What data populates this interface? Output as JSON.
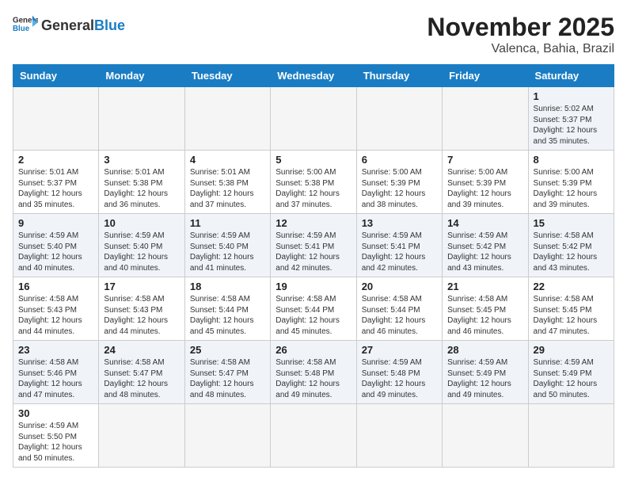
{
  "header": {
    "logo_general": "General",
    "logo_blue": "Blue",
    "month_title": "November 2025",
    "location": "Valenca, Bahia, Brazil"
  },
  "weekdays": [
    "Sunday",
    "Monday",
    "Tuesday",
    "Wednesday",
    "Thursday",
    "Friday",
    "Saturday"
  ],
  "weeks": [
    [
      {
        "day": "",
        "info": ""
      },
      {
        "day": "",
        "info": ""
      },
      {
        "day": "",
        "info": ""
      },
      {
        "day": "",
        "info": ""
      },
      {
        "day": "",
        "info": ""
      },
      {
        "day": "",
        "info": ""
      },
      {
        "day": "1",
        "info": "Sunrise: 5:02 AM\nSunset: 5:37 PM\nDaylight: 12 hours and 35 minutes."
      }
    ],
    [
      {
        "day": "2",
        "info": "Sunrise: 5:01 AM\nSunset: 5:37 PM\nDaylight: 12 hours and 35 minutes."
      },
      {
        "day": "3",
        "info": "Sunrise: 5:01 AM\nSunset: 5:38 PM\nDaylight: 12 hours and 36 minutes."
      },
      {
        "day": "4",
        "info": "Sunrise: 5:01 AM\nSunset: 5:38 PM\nDaylight: 12 hours and 37 minutes."
      },
      {
        "day": "5",
        "info": "Sunrise: 5:00 AM\nSunset: 5:38 PM\nDaylight: 12 hours and 37 minutes."
      },
      {
        "day": "6",
        "info": "Sunrise: 5:00 AM\nSunset: 5:39 PM\nDaylight: 12 hours and 38 minutes."
      },
      {
        "day": "7",
        "info": "Sunrise: 5:00 AM\nSunset: 5:39 PM\nDaylight: 12 hours and 39 minutes."
      },
      {
        "day": "8",
        "info": "Sunrise: 5:00 AM\nSunset: 5:39 PM\nDaylight: 12 hours and 39 minutes."
      }
    ],
    [
      {
        "day": "9",
        "info": "Sunrise: 4:59 AM\nSunset: 5:40 PM\nDaylight: 12 hours and 40 minutes."
      },
      {
        "day": "10",
        "info": "Sunrise: 4:59 AM\nSunset: 5:40 PM\nDaylight: 12 hours and 40 minutes."
      },
      {
        "day": "11",
        "info": "Sunrise: 4:59 AM\nSunset: 5:40 PM\nDaylight: 12 hours and 41 minutes."
      },
      {
        "day": "12",
        "info": "Sunrise: 4:59 AM\nSunset: 5:41 PM\nDaylight: 12 hours and 42 minutes."
      },
      {
        "day": "13",
        "info": "Sunrise: 4:59 AM\nSunset: 5:41 PM\nDaylight: 12 hours and 42 minutes."
      },
      {
        "day": "14",
        "info": "Sunrise: 4:59 AM\nSunset: 5:42 PM\nDaylight: 12 hours and 43 minutes."
      },
      {
        "day": "15",
        "info": "Sunrise: 4:58 AM\nSunset: 5:42 PM\nDaylight: 12 hours and 43 minutes."
      }
    ],
    [
      {
        "day": "16",
        "info": "Sunrise: 4:58 AM\nSunset: 5:43 PM\nDaylight: 12 hours and 44 minutes."
      },
      {
        "day": "17",
        "info": "Sunrise: 4:58 AM\nSunset: 5:43 PM\nDaylight: 12 hours and 44 minutes."
      },
      {
        "day": "18",
        "info": "Sunrise: 4:58 AM\nSunset: 5:44 PM\nDaylight: 12 hours and 45 minutes."
      },
      {
        "day": "19",
        "info": "Sunrise: 4:58 AM\nSunset: 5:44 PM\nDaylight: 12 hours and 45 minutes."
      },
      {
        "day": "20",
        "info": "Sunrise: 4:58 AM\nSunset: 5:44 PM\nDaylight: 12 hours and 46 minutes."
      },
      {
        "day": "21",
        "info": "Sunrise: 4:58 AM\nSunset: 5:45 PM\nDaylight: 12 hours and 46 minutes."
      },
      {
        "day": "22",
        "info": "Sunrise: 4:58 AM\nSunset: 5:45 PM\nDaylight: 12 hours and 47 minutes."
      }
    ],
    [
      {
        "day": "23",
        "info": "Sunrise: 4:58 AM\nSunset: 5:46 PM\nDaylight: 12 hours and 47 minutes."
      },
      {
        "day": "24",
        "info": "Sunrise: 4:58 AM\nSunset: 5:47 PM\nDaylight: 12 hours and 48 minutes."
      },
      {
        "day": "25",
        "info": "Sunrise: 4:58 AM\nSunset: 5:47 PM\nDaylight: 12 hours and 48 minutes."
      },
      {
        "day": "26",
        "info": "Sunrise: 4:58 AM\nSunset: 5:48 PM\nDaylight: 12 hours and 49 minutes."
      },
      {
        "day": "27",
        "info": "Sunrise: 4:59 AM\nSunset: 5:48 PM\nDaylight: 12 hours and 49 minutes."
      },
      {
        "day": "28",
        "info": "Sunrise: 4:59 AM\nSunset: 5:49 PM\nDaylight: 12 hours and 49 minutes."
      },
      {
        "day": "29",
        "info": "Sunrise: 4:59 AM\nSunset: 5:49 PM\nDaylight: 12 hours and 50 minutes."
      }
    ],
    [
      {
        "day": "30",
        "info": "Sunrise: 4:59 AM\nSunset: 5:50 PM\nDaylight: 12 hours and 50 minutes."
      },
      {
        "day": "",
        "info": ""
      },
      {
        "day": "",
        "info": ""
      },
      {
        "day": "",
        "info": ""
      },
      {
        "day": "",
        "info": ""
      },
      {
        "day": "",
        "info": ""
      },
      {
        "day": "",
        "info": ""
      }
    ]
  ]
}
